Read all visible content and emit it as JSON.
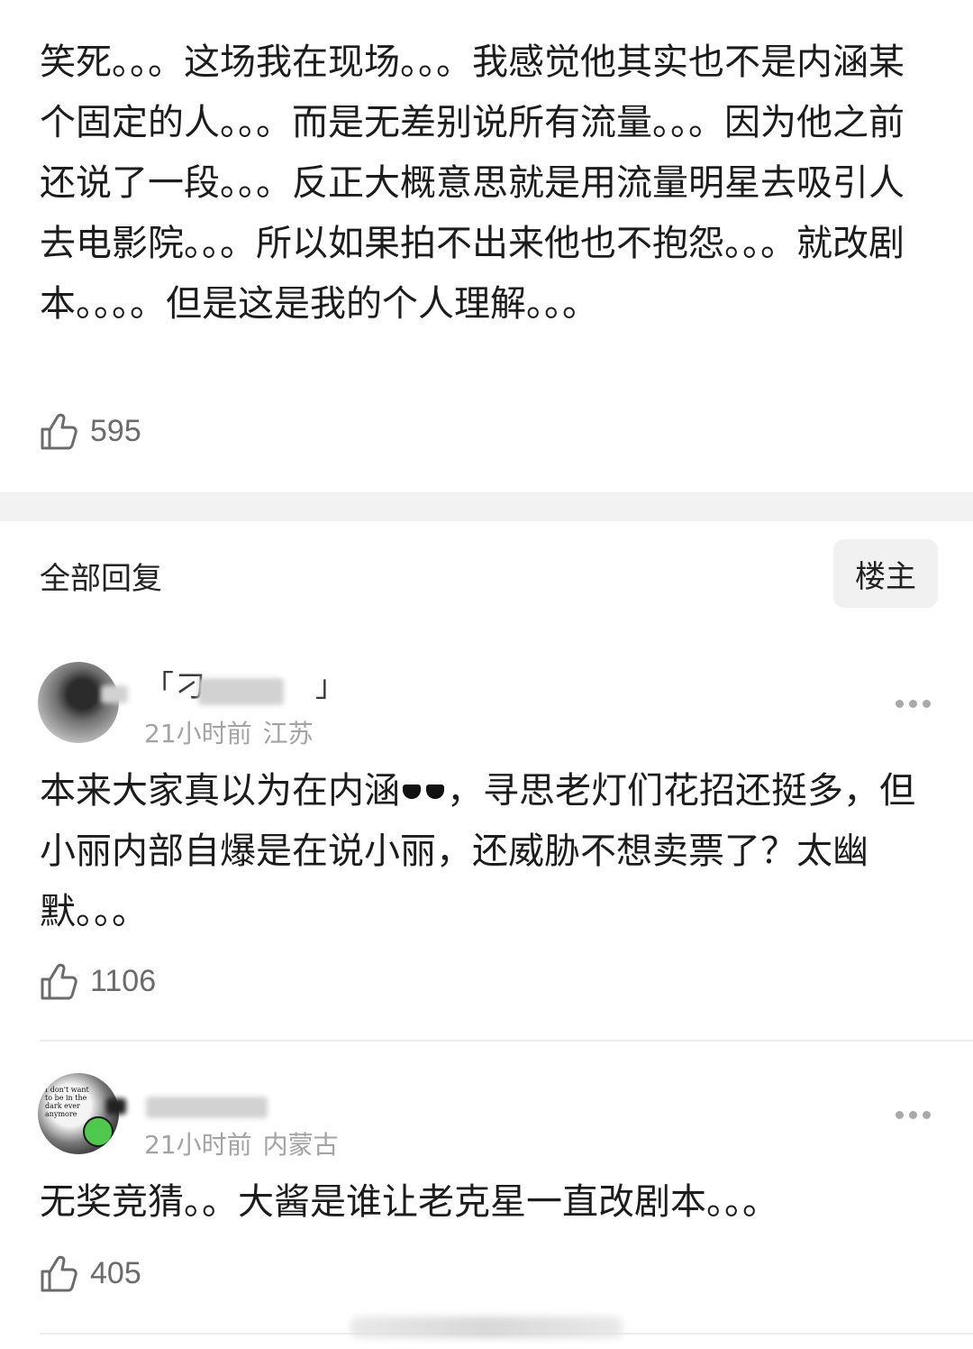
{
  "main_post": {
    "text": "笑死。。。这场我在现场。。。我感觉他其实也不是内涵某个固定的人。。。而是无差别说所有流量。。。因为他之前还说了一段。。。反正大概意思就是用流量明星去吸引人去电影院。。。所以如果拍不出来他也不抱怨。。。就改剧本。。。。但是这是我的个人理解。。。",
    "likes": "595",
    "like_icon": "thumbs-up-icon"
  },
  "replies_section": {
    "title": "全部回复",
    "filter_button": "楼主"
  },
  "replies": [
    {
      "username": "「刁",
      "username_end": "」",
      "time": "21小时前",
      "location": "江苏",
      "text_before": "本来大家真以为在内涵",
      "emoji": "sunglasses-icon",
      "text_after": "，寻思老灯们花招还挺多，但小丽内部自爆是在说小丽，还威胁不想卖票了？太幽默。。。",
      "likes": "1106"
    },
    {
      "username": "",
      "time": "21小时前",
      "location": "内蒙古",
      "avatar_text": "I don't want to be in the dark ever anymore",
      "text": "无奖竞猜。。大酱是谁让老克星一直改剧本。。。",
      "likes": "405"
    }
  ],
  "colors": {
    "text": "#1c1c1c",
    "meta": "#a3a3a3",
    "like_count": "#6b6b6b",
    "divider_band": "#f2f2f2",
    "filter_bg": "#f1f1f1"
  }
}
